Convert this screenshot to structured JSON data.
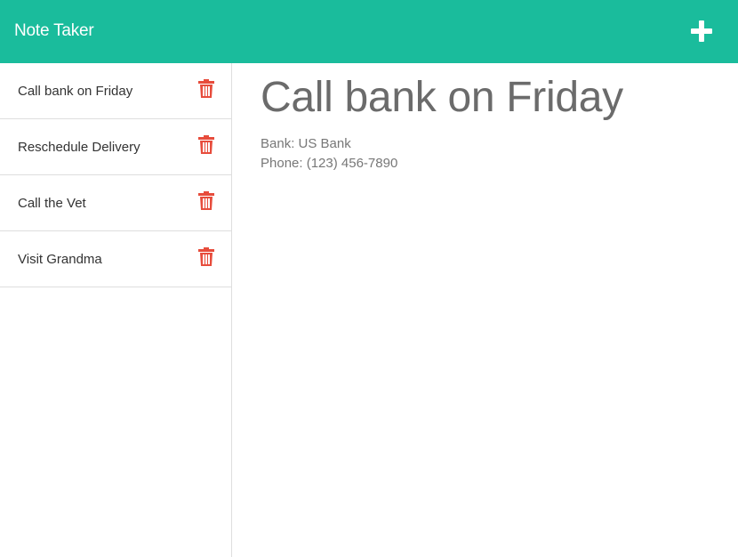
{
  "navbar": {
    "brand": "Note Taker",
    "new_note_icon": "plus-icon",
    "color": "#1abc9c"
  },
  "sidebar": {
    "notes": [
      {
        "title": "Call bank on Friday",
        "delete_icon": "trash-icon"
      },
      {
        "title": "Reschedule Delivery",
        "delete_icon": "trash-icon"
      },
      {
        "title": "Call the Vet",
        "delete_icon": "trash-icon"
      },
      {
        "title": "Visit Grandma",
        "delete_icon": "trash-icon"
      }
    ],
    "delete_color": "#e74c3c"
  },
  "main": {
    "title": "Call bank on Friday",
    "body_lines": [
      "Bank: US Bank",
      "Phone: (123) 456-7890"
    ]
  }
}
